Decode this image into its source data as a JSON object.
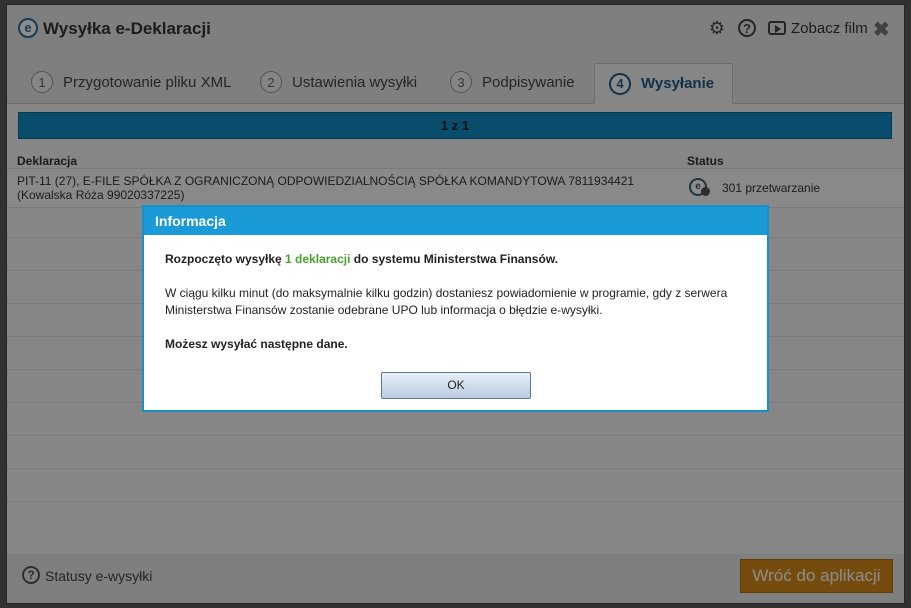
{
  "window": {
    "title": "Wysyłka e-Deklaracji",
    "logo_letter": "e",
    "film_label": "Zobacz film",
    "close_symbol": "✖",
    "help_symbol": "?",
    "gear_symbol": "⚙"
  },
  "tabs": [
    {
      "num": "1",
      "label": "Przygotowanie pliku XML",
      "active": false
    },
    {
      "num": "2",
      "label": "Ustawienia wysyłki",
      "active": false
    },
    {
      "num": "3",
      "label": "Podpisywanie",
      "active": false
    },
    {
      "num": "4",
      "label": "Wysyłanie",
      "active": true
    }
  ],
  "progress": {
    "label": "1 z 1",
    "fraction": 1.0
  },
  "table": {
    "headers": {
      "declaration": "Deklaracja",
      "status": "Status"
    },
    "rows": [
      {
        "line1": "PIT-11 (27), E-FILE SPÓŁKA Z OGRANICZONĄ ODPOWIEDZIALNOŚCIĄ SPÓŁKA KOMANDYTOWA 7811934421",
        "line2": "(Kowalska Róża 99020337225)",
        "status": "301 przetwarzanie"
      }
    ]
  },
  "footer": {
    "help_symbol": "?",
    "status_link": "Statusy e-wysyłki",
    "back_button": "Wróć do aplikacji"
  },
  "dialog": {
    "title": "Informacja",
    "p1_before": "Rozpoczęto wysyłkę ",
    "p1_highlight": "1 deklaracji",
    "p1_after": " do systemu Ministerstwa Finansów.",
    "p2_line1": "W ciągu kilku minut (do maksymalnie kilku godzin) dostaniesz powiadomienie w programie, gdy z serwera",
    "p2_line2": "Ministerstwa Finansów zostanie odebrane UPO lub informacja o błędzie e-wysyłki.",
    "p3": "Możesz wysyłać następne dane.",
    "ok_label": "OK"
  },
  "colors": {
    "accent": "#1a9ad6",
    "progress": "#118ac3",
    "highlight": "#4aa22a",
    "back_button": "#d68a1a"
  }
}
